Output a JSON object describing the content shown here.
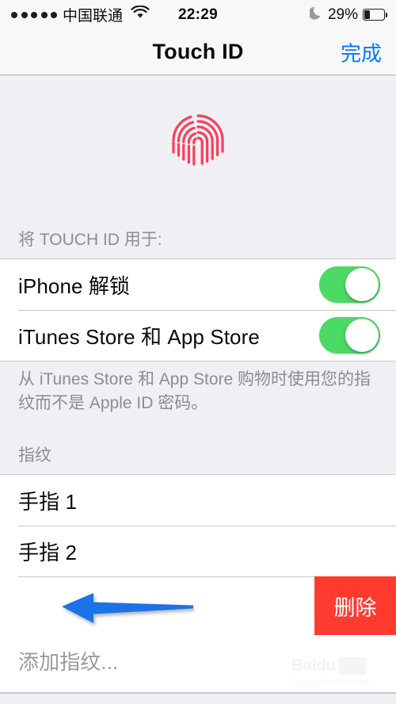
{
  "status_bar": {
    "signal_dots": 5,
    "carrier": "中国联通",
    "wifi_icon": "wifi-icon",
    "time": "22:29",
    "dnd_icon": "moon-icon",
    "battery_percent": "29%",
    "battery_level": 29
  },
  "nav": {
    "title": "Touch ID",
    "done_label": "完成",
    "done_color": "#007AFF"
  },
  "hero": {
    "icon": "fingerprint-icon",
    "icon_color": "#FC3D5A"
  },
  "use_section": {
    "header": "将 TOUCH ID 用于:",
    "rows": [
      {
        "label": "iPhone 解锁",
        "toggle": "on"
      },
      {
        "label": "iTunes Store 和 App Store",
        "toggle": "on"
      }
    ],
    "footer": "从 iTunes Store 和 App Store 购物时使用您的指纹而不是 Apple ID 密码。"
  },
  "fingerprint_section": {
    "header": "指纹",
    "rows": [
      {
        "label": "手指 1"
      },
      {
        "label": "手指 2"
      }
    ],
    "swipe_row": {
      "delete_label": "删除",
      "delete_color": "#FF3B30"
    },
    "add_label": "添加指纹..."
  },
  "annotation": {
    "arrow": "left-arrow-annotation",
    "color": "#1E72E8"
  },
  "watermark": {
    "brand": "Baidu",
    "suffix": "经验",
    "url": "jingyan.baidu.com"
  },
  "colors": {
    "background": "#EFEFF4",
    "bar": "#F8F8F8",
    "row": "#FFFFFF",
    "separator": "#C8C7CC",
    "toggle_on": "#4CD964",
    "muted_text": "#8C8C91"
  }
}
